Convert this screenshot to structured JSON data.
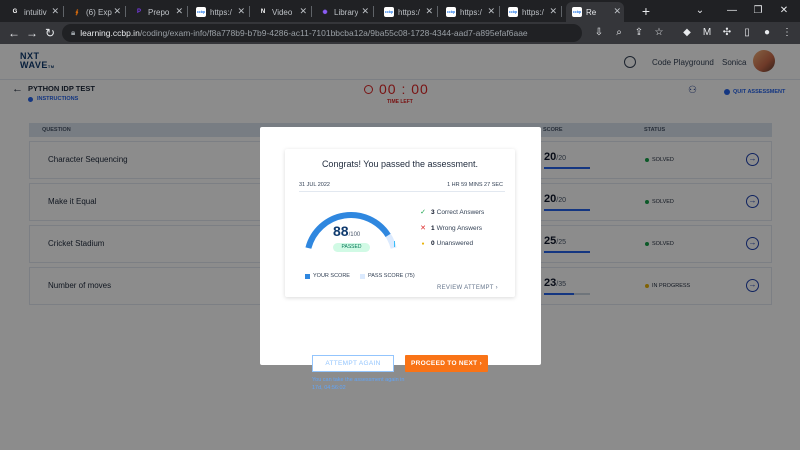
{
  "browser": {
    "tabs": [
      {
        "label": "intuitiv",
        "favicon": "G",
        "color": "#ffffff"
      },
      {
        "label": "(6) Exp",
        "favicon": "∮",
        "color": "#e8710a"
      },
      {
        "label": "Prepo",
        "favicon": "P",
        "color": "#7c3aed"
      },
      {
        "label": "https:/",
        "favicon": "ccbp",
        "color": "#1a73e8"
      },
      {
        "label": "Video",
        "favicon": "N",
        "color": "#ffffff"
      },
      {
        "label": "Library",
        "favicon": "✺",
        "color": "#8b5cf6"
      },
      {
        "label": "https:/",
        "favicon": "ccbp",
        "color": "#1a73e8"
      },
      {
        "label": "https:/",
        "favicon": "ccbp",
        "color": "#1a73e8"
      },
      {
        "label": "https:/",
        "favicon": "ccbp",
        "color": "#1a73e8"
      },
      {
        "label": "Re",
        "favicon": "ccbp",
        "color": "#1a73e8"
      }
    ],
    "url_host": "learning.ccbp.in",
    "url_path": "/coding/exam-info/f8a778b9-b7b9-4286-ac11-7101bbcba12a/9ba55c08-1728-4344-aad7-a895efaf6aae"
  },
  "header": {
    "logo_line1": "NXT",
    "logo_line2": "WAVE",
    "logo_tm": "TM",
    "playground_label": "Code Playground",
    "user_name": "Sonica"
  },
  "exam": {
    "title": "PYTHON IDP TEST",
    "instructions_label": "INSTRUCTIONS",
    "timer": "00 : 00",
    "timer_label": "TIME LEFT",
    "quit_label": "QUIT ASSESSMENT"
  },
  "table": {
    "headers": {
      "question": "QUESTION",
      "score": "SCORE",
      "status": "STATUS"
    },
    "rows": [
      {
        "name": "Character Sequencing",
        "score": "20",
        "max": "/20",
        "fraction": 1.0,
        "status": "SOLVED",
        "status_color": "#16a34a"
      },
      {
        "name": "Make it Equal",
        "score": "20",
        "max": "/20",
        "fraction": 1.0,
        "status": "SOLVED",
        "status_color": "#16a34a"
      },
      {
        "name": "Cricket Stadium",
        "score": "25",
        "max": "/25",
        "fraction": 1.0,
        "status": "SOLVED",
        "status_color": "#16a34a"
      },
      {
        "name": "Number of moves",
        "score": "23",
        "max": "/35",
        "fraction": 0.657,
        "status": "IN PROGRESS",
        "status_color": "#eab308"
      }
    ]
  },
  "modal": {
    "congrats": "Congrats! You passed the assessment.",
    "date": "31 JUL 2022",
    "duration": "1 HR 59 MINS 27 SEC",
    "score": "88",
    "score_max": "/100",
    "score_fraction": 0.88,
    "pass_fraction": 0.75,
    "passed_label": "PASSED",
    "results": [
      {
        "count": "3",
        "label": "Correct Answers",
        "icon": "check-icon",
        "color": "#16a34a"
      },
      {
        "count": "1",
        "label": "Wrong Answers",
        "icon": "cross-icon",
        "color": "#dc2626"
      },
      {
        "count": "0",
        "label": "Unanswered",
        "icon": "dot-icon",
        "color": "#eab308"
      }
    ],
    "legend_your_score": "YOUR SCORE",
    "legend_pass_score": "PASS SCORE (75)",
    "review_label": "REVIEW ATTEMPT",
    "attempt_again_label": "ATTEMPT AGAIN",
    "proceed_label": "PROCEED TO NEXT",
    "retry_note": "You can take the assessment again in 17d, 04:56:02"
  },
  "colors": {
    "accent": "#2563eb",
    "brand": "#0f3a6e",
    "proceed": "#f97316",
    "timer": "#dc2626"
  }
}
